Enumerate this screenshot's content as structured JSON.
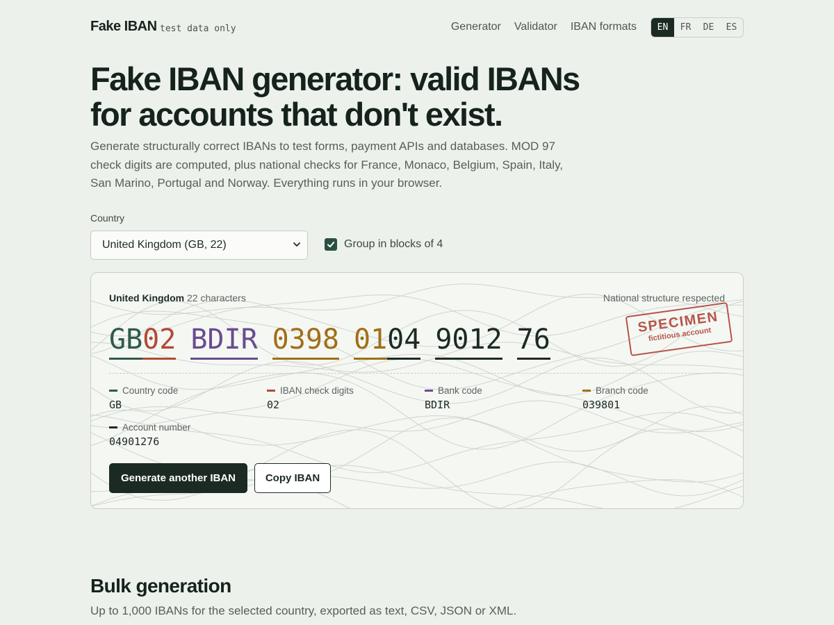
{
  "header": {
    "logo": "Fake IBAN",
    "logo_tag": "test data only",
    "nav": [
      "Generator",
      "Validator",
      "IBAN formats"
    ],
    "languages": [
      "EN",
      "FR",
      "DE",
      "ES"
    ],
    "active_language": "EN"
  },
  "hero": {
    "title": "Fake IBAN generator: valid IBANs for accounts that don't exist.",
    "description": "Generate structurally correct IBANs to test forms, payment APIs and databases. MOD 97 check digits are computed, plus national checks for France, Monaco, Belgium, Spain, Italy, San Marino, Portugal and Norway. Everything runs in your browser."
  },
  "controls": {
    "country_label": "Country",
    "country_value": "United Kingdom (GB, 22)",
    "group_label": "Group in blocks of 4",
    "group_checked": true
  },
  "card": {
    "country_name": "United Kingdom",
    "length_text": "22 characters",
    "national_text": "National structure respected",
    "iban_groups": [
      [
        {
          "text": "GB",
          "part": "country"
        },
        {
          "text": "02",
          "part": "check"
        }
      ],
      [
        {
          "text": "BDIR",
          "part": "bank"
        }
      ],
      [
        {
          "text": "0398",
          "part": "branch"
        }
      ],
      [
        {
          "text": "01",
          "part": "branch"
        },
        {
          "text": "04",
          "part": "account"
        }
      ],
      [
        {
          "text": "9012",
          "part": "account"
        }
      ],
      [
        {
          "text": "76",
          "part": "account"
        }
      ]
    ],
    "stamp": {
      "main": "SPECIMEN",
      "sub": "fictitious account"
    },
    "legend": [
      {
        "label": "Country code",
        "value": "GB",
        "part": "country"
      },
      {
        "label": "IBAN check digits",
        "value": "02",
        "part": "check"
      },
      {
        "label": "Bank code",
        "value": "BDIR",
        "part": "bank"
      },
      {
        "label": "Branch code",
        "value": "039801",
        "part": "branch"
      },
      {
        "label": "Account number",
        "value": "04901276",
        "part": "account"
      }
    ],
    "generate_label": "Generate another IBAN",
    "copy_label": "Copy IBAN"
  },
  "colors": {
    "country": "#2f5a4c",
    "check": "#b24a36",
    "bank": "#6a4b8f",
    "branch": "#a06f17",
    "account": "#1c2a24",
    "accent": "#1c2a24"
  },
  "bulk": {
    "title": "Bulk generation",
    "description": "Up to 1,000 IBANs for the selected country, exported as text, CSV, JSON or XML."
  }
}
